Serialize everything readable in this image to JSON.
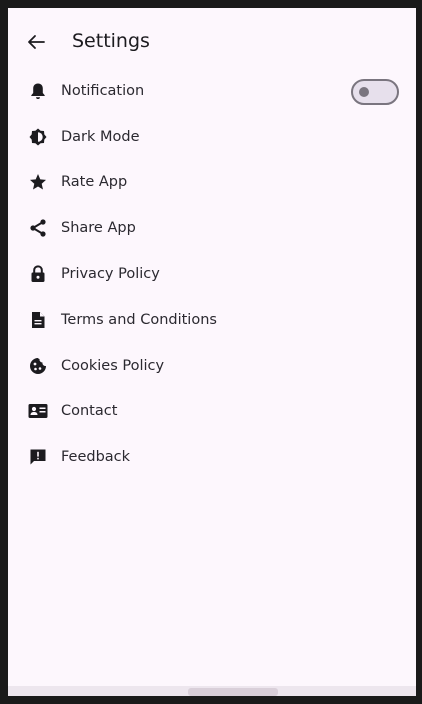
{
  "header": {
    "title": "Settings",
    "back_icon": "arrow-left-icon"
  },
  "settings": {
    "items": [
      {
        "label": "Notification",
        "icon": "bell-icon",
        "has_toggle": true,
        "toggle_on": false
      },
      {
        "label": "Dark Mode",
        "icon": "brightness-icon"
      },
      {
        "label": "Rate App",
        "icon": "star-icon"
      },
      {
        "label": "Share App",
        "icon": "share-icon"
      },
      {
        "label": "Privacy Policy",
        "icon": "lock-icon"
      },
      {
        "label": "Terms and Conditions",
        "icon": "document-icon"
      },
      {
        "label": "Cookies Policy",
        "icon": "cookie-icon"
      },
      {
        "label": "Contact",
        "icon": "contact-card-icon"
      },
      {
        "label": "Feedback",
        "icon": "feedback-icon"
      }
    ]
  },
  "colors": {
    "background": "#fdf7fd",
    "text": "#2b2930",
    "icon": "#1c1b1f",
    "toggle_outline": "#7a757f"
  }
}
